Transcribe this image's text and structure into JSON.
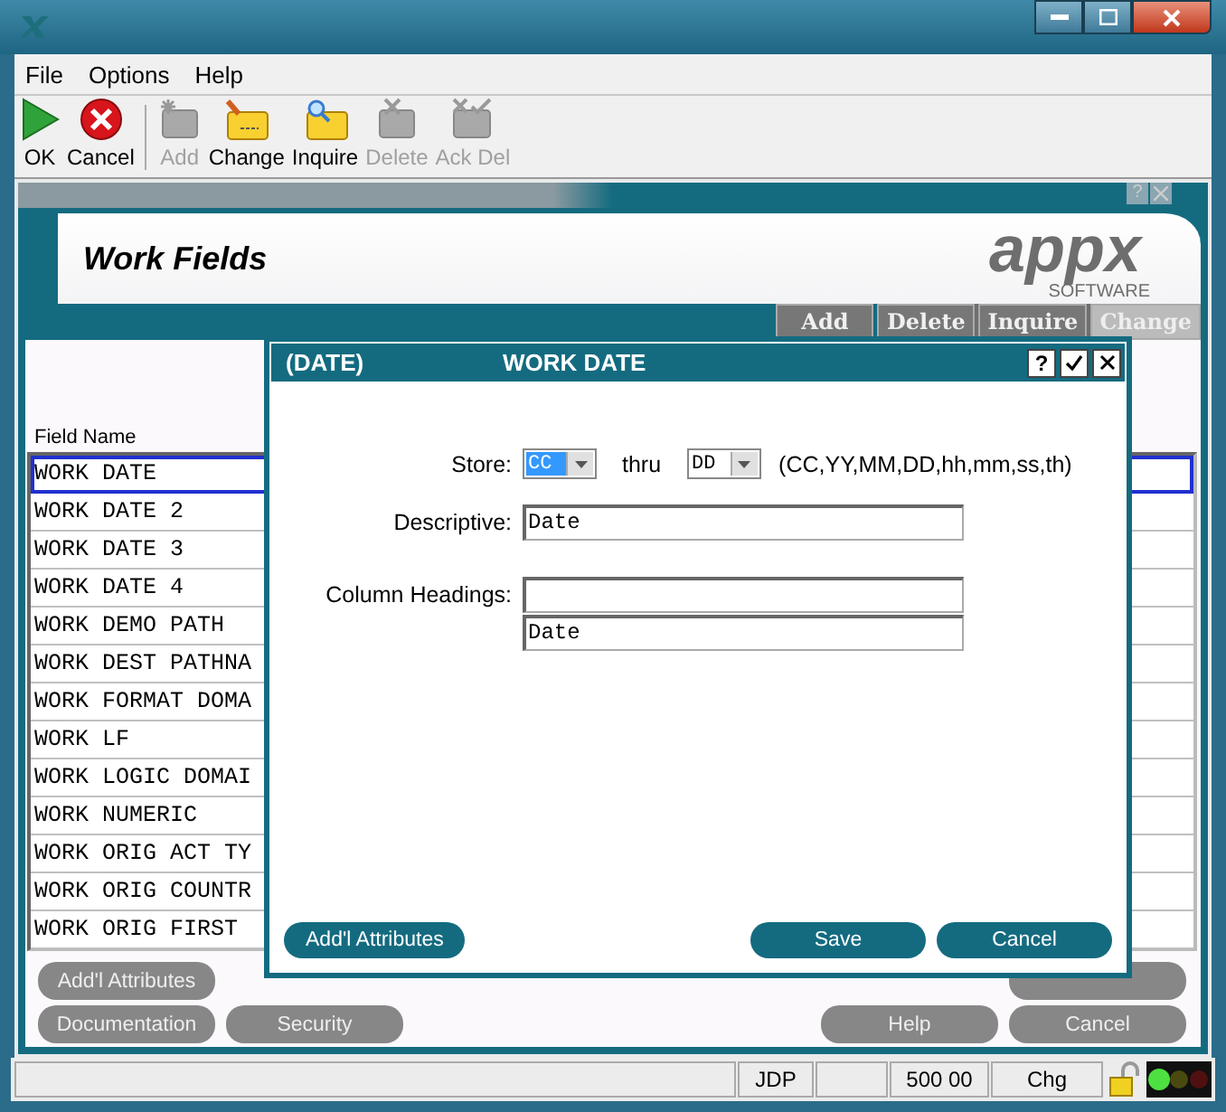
{
  "menu": [
    "File",
    "Options",
    "Help"
  ],
  "toolbar": [
    {
      "label": "OK",
      "kind": "ok",
      "disabled": false
    },
    {
      "label": "Cancel",
      "kind": "cancel",
      "disabled": false
    },
    {
      "label": "Add",
      "kind": "add",
      "disabled": true
    },
    {
      "label": "Change",
      "kind": "change",
      "disabled": false
    },
    {
      "label": "Inquire",
      "kind": "inquire",
      "disabled": false
    },
    {
      "label": "Delete",
      "kind": "delete",
      "disabled": true
    },
    {
      "label": "Ack Del",
      "kind": "ackdel",
      "disabled": true
    }
  ],
  "screen": {
    "title": "Work Fields",
    "logo": {
      "name": "appx",
      "tagline": "SOFTWARE"
    },
    "tabs": [
      {
        "label": "Add",
        "selected": false
      },
      {
        "label": "Delete",
        "selected": false
      },
      {
        "label": "Inquire",
        "selected": false
      },
      {
        "label": "Change",
        "selected": true
      }
    ],
    "help_label": "?",
    "column_heading": "Field Name",
    "rows": [
      {
        "text": "WORK DATE",
        "selected": true
      },
      {
        "text": "WORK DATE 2",
        "selected": false
      },
      {
        "text": "WORK DATE 3",
        "selected": false
      },
      {
        "text": "WORK DATE 4",
        "selected": false
      },
      {
        "text": "WORK DEMO PATH",
        "selected": false
      },
      {
        "text": "WORK DEST PATHNA",
        "selected": false
      },
      {
        "text": "WORK FORMAT DOMA",
        "selected": false
      },
      {
        "text": "WORK LF",
        "selected": false
      },
      {
        "text": "WORK LOGIC DOMAI",
        "selected": false
      },
      {
        "text": "WORK NUMERIC",
        "selected": false
      },
      {
        "text": "WORK ORIG ACT TY",
        "selected": false
      },
      {
        "text": "WORK ORIG COUNTR",
        "selected": false
      },
      {
        "text": "WORK ORIG FIRST",
        "selected": false
      }
    ],
    "left_buttons": [
      [
        "Add'l Attributes"
      ],
      [
        "Documentation",
        "Security"
      ]
    ],
    "covered_button": true,
    "right_buttons": [
      [
        "Help",
        "Cancel"
      ]
    ]
  },
  "dialog": {
    "type": "(DATE)",
    "title": "WORK DATE",
    "help_label": "?",
    "store_label": "Store:",
    "store_from": "CC",
    "thru_label": "thru",
    "store_to": "DD",
    "format_hint": "(CC,YY,MM,DD,hh,mm,ss,th)",
    "descriptive_label": "Descriptive:",
    "descriptive": "Date",
    "headings_label": "Column Headings:",
    "heading_line_2": "Date",
    "attributes_button": "Add'l Attributes",
    "save_button": "Save",
    "cancel_button": "Cancel"
  },
  "status_bar": {
    "user": "JDP",
    "code": "500 00",
    "mode": "Chg"
  }
}
